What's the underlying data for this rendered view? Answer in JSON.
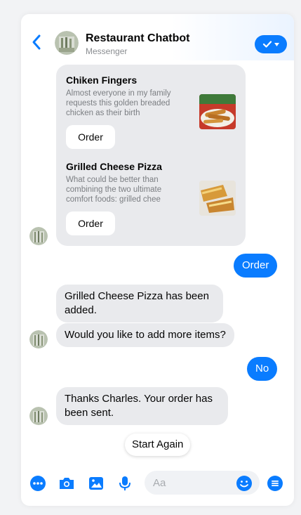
{
  "header": {
    "title": "Restaurant Chatbot",
    "subtitle": "Messenger"
  },
  "carousel": {
    "items": [
      {
        "title": "Chiken Fingers",
        "description": "Almost everyone in my family requests this golden breaded chicken as their birth",
        "button_label": "Order",
        "image_icon": "chicken-fingers-photo"
      },
      {
        "title": "Grilled Cheese Pizza",
        "description": "What could be better than combining the two ultimate comfort foods: grilled chee",
        "button_label": "Order",
        "image_icon": "grilled-cheese-pizza-photo"
      }
    ]
  },
  "messages": [
    {
      "side": "out",
      "text": "Order"
    },
    {
      "side": "in",
      "text": "Grilled Cheese Pizza has been added."
    },
    {
      "side": "in",
      "text": "Would you like to add more items?"
    },
    {
      "side": "out",
      "text": "No"
    },
    {
      "side": "in",
      "text": "Thanks Charles. Your order has been sent."
    }
  ],
  "quick_reply": {
    "label": "Start Again"
  },
  "composer": {
    "placeholder": "Aa",
    "icons": [
      "more-icon",
      "camera-icon",
      "image-icon",
      "microphone-icon",
      "emoji-icon",
      "menu-icon"
    ]
  },
  "colors": {
    "accent": "#0a7cff",
    "incoming_bubble": "#e9eaed",
    "background": "#f2f3f5"
  }
}
